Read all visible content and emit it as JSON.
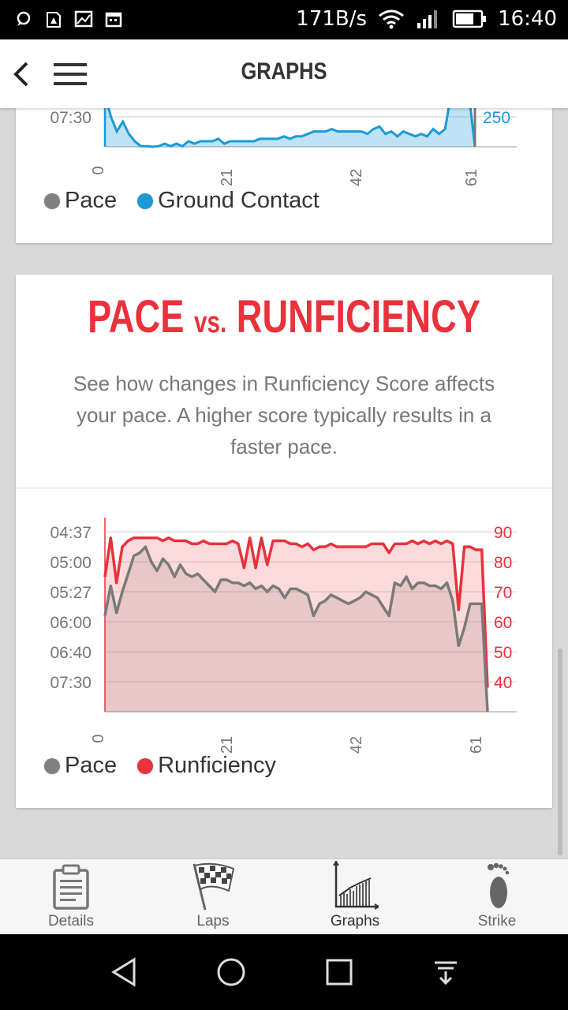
{
  "status_bar": {
    "net_speed": "171B/s",
    "time": "16:40"
  },
  "app_bar": {
    "title": "GRAPHS"
  },
  "chart_top": {
    "y_left_label": "07:30",
    "y_right_label": "250",
    "x_ticks": [
      "0",
      "21",
      "42",
      "61"
    ],
    "legend": [
      {
        "label": "Pace",
        "color": "#808080"
      },
      {
        "label": "Ground Contact",
        "color": "#1a9ad6"
      }
    ]
  },
  "pace_card": {
    "title_a": "PACE",
    "title_vs": "vs.",
    "title_b": "RUNFICIENCY",
    "description": "See how changes in Runficiency Score affects your pace. A higher score typically results in a faster pace.",
    "legend": [
      {
        "label": "Pace",
        "color": "#808080"
      },
      {
        "label": "Runficiency",
        "color": "#e8323c"
      }
    ]
  },
  "chart_data": [
    {
      "type": "area",
      "series": [
        {
          "name": "Ground Contact",
          "color": "#1a9ad6",
          "values": [
            262,
            250,
            244,
            248,
            243,
            240,
            238,
            238,
            237,
            238,
            239,
            238,
            239,
            238,
            240,
            239,
            240,
            240,
            240,
            241,
            239,
            240,
            240,
            240,
            240,
            240,
            241,
            241,
            241,
            241,
            242,
            241,
            242,
            242,
            243,
            244,
            244,
            244,
            245,
            244,
            244,
            244,
            244,
            244,
            243,
            245,
            246,
            243,
            244,
            242,
            244,
            243,
            242,
            243,
            242,
            245,
            243,
            245,
            275,
            273,
            263,
            263,
            200
          ]
        },
        {
          "name": "Pace",
          "color": "#808080",
          "values": []
        }
      ],
      "x_range": [
        0,
        62
      ],
      "x_ticks": [
        "0",
        "21",
        "42",
        "61"
      ],
      "y_left_ticks": [
        "07:30"
      ],
      "y_right_ticks": [
        "250"
      ],
      "legend_position": "bottom-left"
    },
    {
      "type": "area",
      "title": "PACE vs. RUNFICIENCY",
      "x_range": [
        0,
        62
      ],
      "x_ticks": [
        "0",
        "21",
        "42",
        "61"
      ],
      "y_left_ticks": [
        "04:37",
        "05:00",
        "05:27",
        "06:00",
        "06:40",
        "07:30"
      ],
      "y_right_ticks": [
        "90",
        "80",
        "70",
        "60",
        "50",
        "40"
      ],
      "y_right_range": [
        30,
        90
      ],
      "series": [
        {
          "name": "Runficiency",
          "color": "#e8323c",
          "values": [
            75,
            88,
            73,
            85,
            87,
            88,
            88,
            88,
            88,
            88,
            87,
            88,
            87,
            87,
            87,
            86,
            86,
            87,
            86,
            86,
            86,
            86,
            87,
            86,
            78,
            88,
            78,
            88,
            79,
            87,
            87,
            87,
            86,
            86,
            85,
            86,
            84,
            85,
            85,
            86,
            85,
            85,
            85,
            85,
            85,
            85,
            86,
            86,
            86,
            83,
            86,
            86,
            86,
            87,
            86,
            87,
            86,
            87,
            86,
            87,
            86,
            64,
            85,
            85,
            84,
            84,
            38
          ]
        },
        {
          "name": "Pace",
          "color": "#808080",
          "values": [
            62,
            72,
            63,
            70,
            76,
            82,
            83,
            85,
            80,
            77,
            81,
            79,
            75,
            79,
            76,
            75,
            76,
            74,
            72,
            70,
            74,
            74,
            73,
            73,
            72,
            73,
            71,
            72,
            70,
            72,
            71,
            68,
            71,
            71,
            70,
            69,
            62,
            66,
            67,
            69,
            68,
            67,
            66,
            67,
            68,
            70,
            69,
            68,
            65,
            62,
            73,
            72,
            75,
            71,
            73,
            73,
            72,
            72,
            71,
            73,
            67,
            52,
            58,
            66,
            66,
            66,
            30
          ]
        }
      ],
      "legend_position": "bottom-left"
    }
  ]
}
